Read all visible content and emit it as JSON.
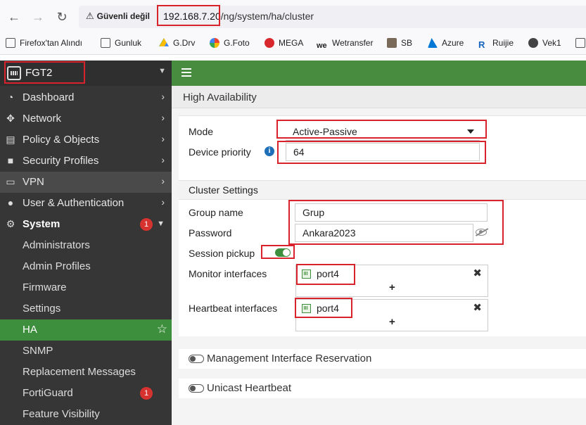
{
  "browser": {
    "security_label": "Güvenli değil",
    "url_host": "192.168.7.20",
    "url_path": "/ng/system/ha/cluster",
    "bookmarks": [
      {
        "label": "Firefox'tan Alındı",
        "icon": "folder-icon",
        "color": "#555555"
      },
      {
        "label": "Gunluk",
        "icon": "folder-icon",
        "color": "#555555"
      },
      {
        "label": "G.Drv",
        "icon": "google-drive-icon",
        "color": "#1ea362"
      },
      {
        "label": "G.Foto",
        "icon": "google-photos-icon",
        "color": "#fbbc04"
      },
      {
        "label": "MEGA",
        "icon": "mega-icon",
        "color": "#d9272e"
      },
      {
        "label": "Wetransfer",
        "icon": "wetransfer-icon",
        "color": "#17181a"
      },
      {
        "label": "SB",
        "icon": "sb-thumbnail-icon",
        "color": "#7a6a5a"
      },
      {
        "label": "Azure",
        "icon": "azure-icon",
        "color": "#0078d4"
      },
      {
        "label": "Ruijie",
        "icon": "ruijie-icon",
        "color": "#1565c0"
      },
      {
        "label": "Vek1",
        "icon": "globe-icon",
        "color": "#444444"
      }
    ]
  },
  "sidebar": {
    "device_name": "FGT2",
    "menu": [
      {
        "label": "Dashboard",
        "icon": "dashboard-icon"
      },
      {
        "label": "Network",
        "icon": "network-icon"
      },
      {
        "label": "Policy & Objects",
        "icon": "policy-icon"
      },
      {
        "label": "Security Profiles",
        "icon": "lock-icon"
      },
      {
        "label": "VPN",
        "icon": "laptop-icon"
      },
      {
        "label": "User & Authentication",
        "icon": "user-icon"
      },
      {
        "label": "System",
        "icon": "gear-icon",
        "badge": "1"
      }
    ],
    "system_submenu": [
      {
        "label": "Administrators"
      },
      {
        "label": "Admin Profiles"
      },
      {
        "label": "Firmware"
      },
      {
        "label": "Settings"
      },
      {
        "label": "HA"
      },
      {
        "label": "SNMP"
      },
      {
        "label": "Replacement Messages"
      },
      {
        "label": "FortiGuard",
        "badge": "1"
      },
      {
        "label": "Feature Visibility"
      }
    ]
  },
  "page": {
    "title": "High Availability",
    "mode_label": "Mode",
    "mode_value": "Active-Passive",
    "priority_label": "Device priority",
    "priority_value": "64",
    "cluster_section": "Cluster Settings",
    "group_label": "Group name",
    "group_value": "Grup",
    "password_label": "Password",
    "password_value": "Ankara2023",
    "session_label": "Session pickup",
    "session_enabled": true,
    "monitor_label": "Monitor interfaces",
    "monitor_ports": [
      "port4"
    ],
    "heartbeat_label": "Heartbeat interfaces",
    "heartbeat_ports": [
      "port4"
    ],
    "mgmt_label": "Management Interface Reservation",
    "mgmt_enabled": false,
    "unicast_label": "Unicast Heartbeat",
    "unicast_enabled": false
  },
  "colors": {
    "accent_green": "#478c3f",
    "highlight_red": "#d9222c",
    "badge_red": "#d6322f"
  }
}
